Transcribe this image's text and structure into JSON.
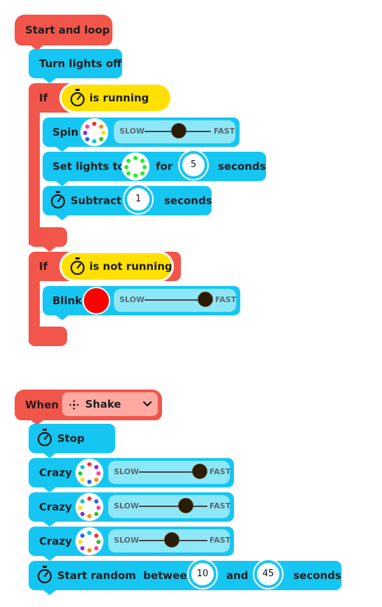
{
  "program": {
    "start_hat": {
      "label": "Start and loop"
    },
    "turn_lights_off": {
      "label": "Turn lights off"
    },
    "if_running": {
      "label": "If",
      "condition": "is running",
      "icon": "stopwatch-icon"
    },
    "spin": {
      "label": "Spin",
      "slow": "SLOW",
      "fast": "FAST",
      "speed": 0.6
    },
    "set_lights": {
      "label": "Set lights to",
      "for": "for",
      "value": "5",
      "unit": "seconds",
      "color": "#22ee22"
    },
    "subtract": {
      "label": "Subtract",
      "value": "1",
      "unit": "seconds",
      "icon": "stopwatch-icon"
    },
    "if_not_running": {
      "label": "If",
      "condition": "is not running",
      "icon": "stopwatch-icon"
    },
    "blink": {
      "label": "Blink",
      "slow": "SLOW",
      "fast": "FAST",
      "speed": 0.9,
      "color": "#ff0000"
    },
    "when_hat": {
      "label": "When",
      "event": "Shake",
      "event_icon": "move-arrows-icon",
      "dropdown_icon": "chevron-down-icon"
    },
    "stop": {
      "label": "Stop",
      "icon": "stopwatch-icon"
    },
    "crazy_1": {
      "label": "Crazy",
      "slow": "SLOW",
      "fast": "FAST",
      "speed": 0.9
    },
    "crazy_2": {
      "label": "Crazy",
      "slow": "SLOW",
      "fast": "FAST",
      "speed": 0.7
    },
    "crazy_3": {
      "label": "Crazy",
      "slow": "SLOW",
      "fast": "FAST",
      "speed": 0.5
    },
    "start_random": {
      "label": "Start random  between",
      "value_min": "10",
      "and": "and",
      "value_max": "45",
      "unit": "seconds",
      "icon": "stopwatch-icon"
    }
  },
  "colors": {
    "control_red": "#f2554a",
    "action_blue": "#16c6f2",
    "condition_yellow": "#ffe000",
    "slider_bg": "#8ee7f7",
    "rainbow": [
      "#ff2b2b",
      "#ff8a00",
      "#ffe000",
      "#28c828",
      "#00c8c8",
      "#2060ff",
      "#8a2be2",
      "#ff3fa0"
    ]
  }
}
